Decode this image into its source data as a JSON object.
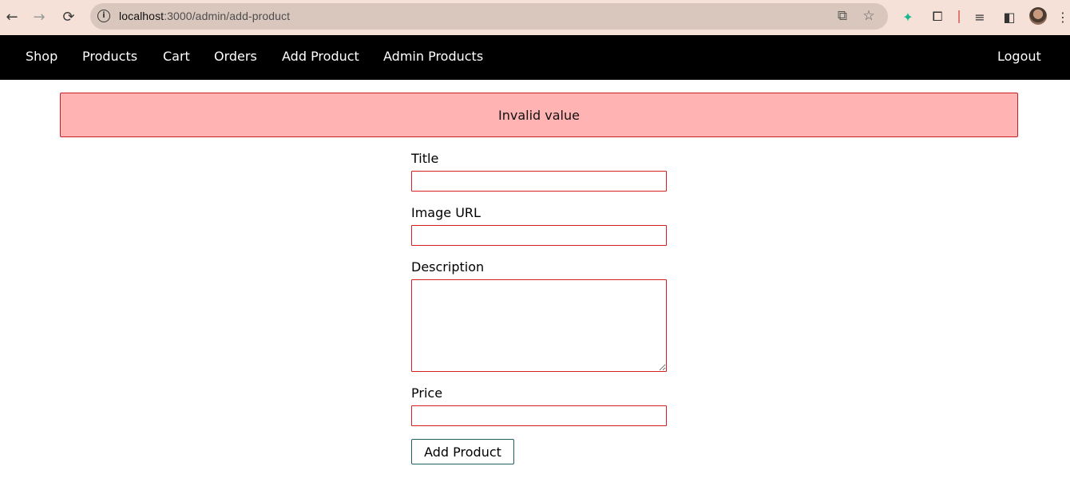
{
  "browser": {
    "back_icon": "←",
    "forward_icon": "→",
    "reload_icon": "⟳",
    "url_host": "localhost",
    "url_path": ":3000/admin/add-product",
    "open_in_app_icon": "⧉",
    "bookmark_icon": "☆",
    "extension_icon_1": "✦",
    "extensions_icon": "⧠",
    "media_icon": "≡",
    "sidepanel_icon": "◧",
    "menu_icon": "⋮"
  },
  "nav": {
    "items": [
      {
        "label": "Shop"
      },
      {
        "label": "Products"
      },
      {
        "label": "Cart"
      },
      {
        "label": "Orders"
      },
      {
        "label": "Add Product"
      },
      {
        "label": "Admin Products"
      }
    ],
    "logout_label": "Logout"
  },
  "alert": {
    "message": "Invalid value",
    "background": "#ffb3b3",
    "border": "#cc1e1e"
  },
  "form": {
    "title_label": "Title",
    "title_value": "",
    "image_url_label": "Image URL",
    "image_url_value": "",
    "description_label": "Description",
    "description_value": "",
    "price_label": "Price",
    "price_value": "",
    "submit_label": "Add Product",
    "invalid_border_color": "#d61f1f"
  }
}
